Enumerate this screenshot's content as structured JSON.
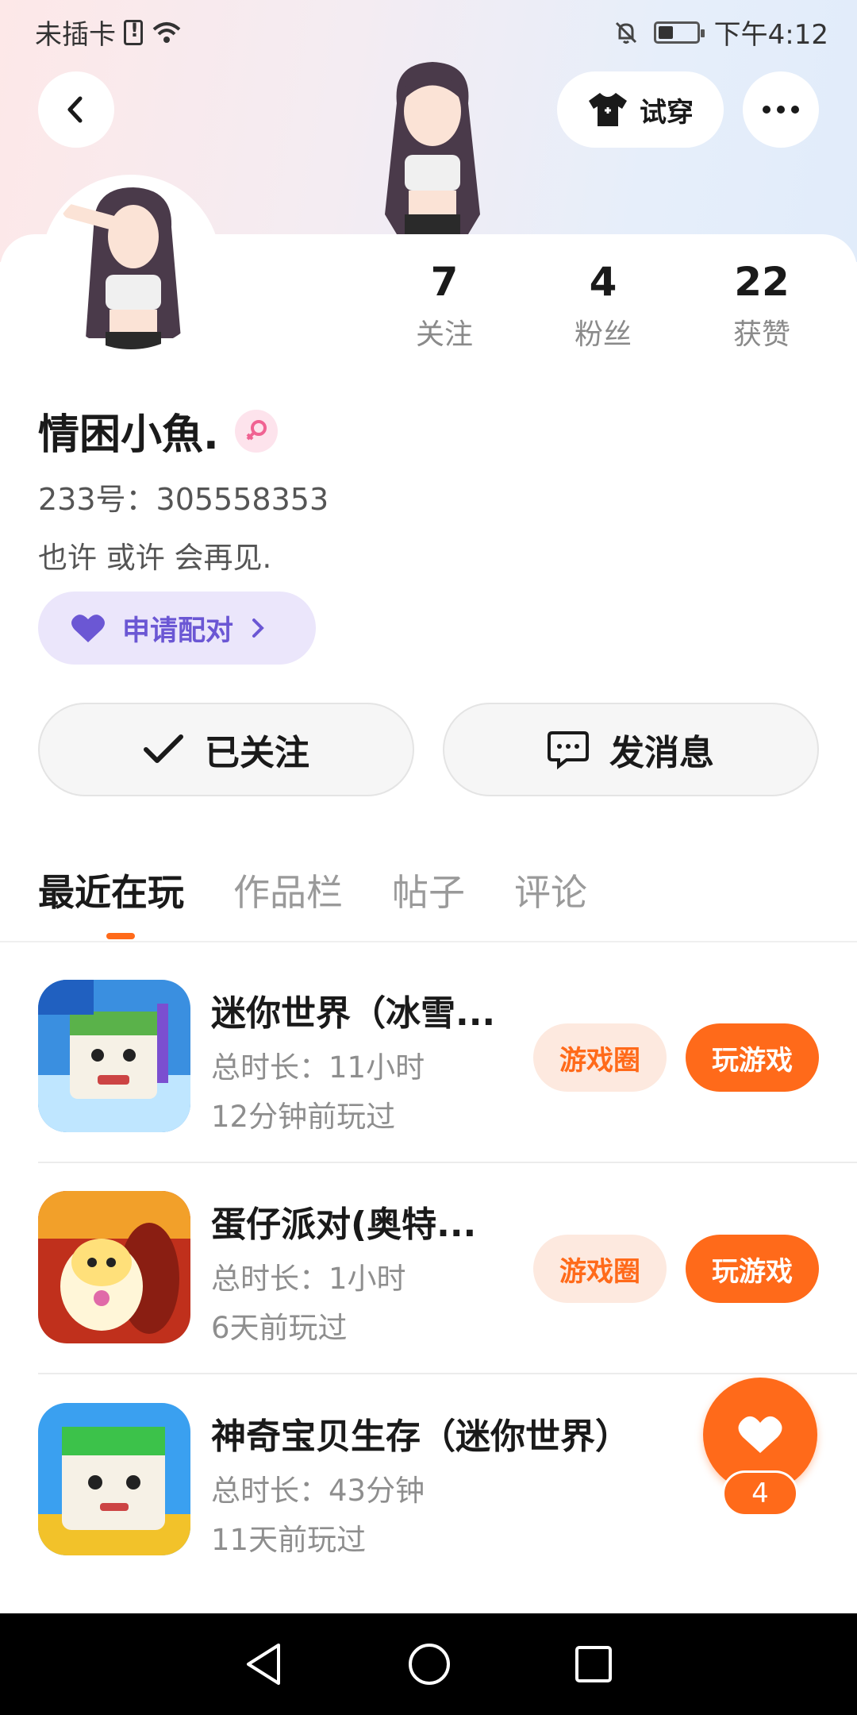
{
  "status_bar": {
    "carrier": "未插卡",
    "time": "下午4:12"
  },
  "header": {
    "try_on_label": "试穿"
  },
  "profile": {
    "stats": [
      {
        "value": "7",
        "label": "关注"
      },
      {
        "value": "4",
        "label": "粉丝"
      },
      {
        "value": "22",
        "label": "获赞"
      }
    ],
    "username": "情困小魚.",
    "uid": "233号：305558353",
    "bio": "也许 或许 会再见.",
    "pair_label": "申请配对",
    "follow_label": "已关注",
    "message_label": "发消息"
  },
  "tabs": [
    {
      "label": "最近在玩"
    },
    {
      "label": "作品栏"
    },
    {
      "label": "帖子"
    },
    {
      "label": "评论"
    }
  ],
  "games": [
    {
      "title": "迷你世界（冰雪...",
      "duration": "总时长：11小时",
      "last_played": "12分钟前玩过",
      "circle_label": "游戏圈",
      "play_label": "玩游戏"
    },
    {
      "title": "蛋仔派对(奥特...",
      "duration": "总时长：1小时",
      "last_played": "6天前玩过",
      "circle_label": "游戏圈",
      "play_label": "玩游戏"
    },
    {
      "title": "神奇宝贝生存（迷你世界）",
      "duration": "总时长：43分钟",
      "last_played": "11天前玩过"
    }
  ],
  "like_fab": {
    "count": "4"
  },
  "colors": {
    "accent": "#ff6a1a",
    "pair_text": "#6b57d4",
    "pair_bg": "#ebe6fb"
  }
}
